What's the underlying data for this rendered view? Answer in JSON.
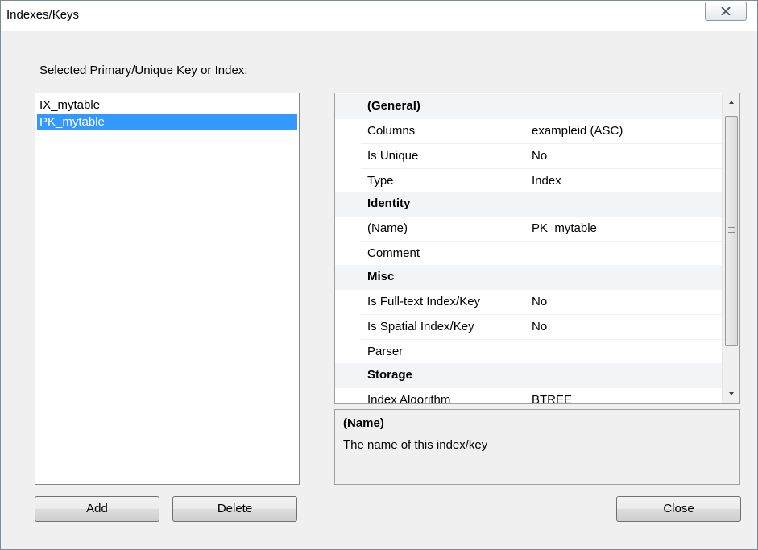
{
  "window": {
    "title": "Indexes/Keys"
  },
  "prompt": "Selected Primary/Unique Key or Index:",
  "key_list": {
    "items": [
      "IX_mytable",
      "PK_mytable"
    ],
    "selected": "PK_mytable"
  },
  "buttons": {
    "add": "Add",
    "delete": "Delete",
    "close": "Close"
  },
  "property_grid": {
    "categories": [
      {
        "name": "(General)",
        "rows": [
          {
            "name": "Columns",
            "value": "exampleid (ASC)"
          },
          {
            "name": "Is Unique",
            "value": "No"
          },
          {
            "name": "Type",
            "value": "Index"
          }
        ]
      },
      {
        "name": "Identity",
        "rows": [
          {
            "name": "(Name)",
            "value": "PK_mytable"
          },
          {
            "name": "Comment",
            "value": ""
          }
        ]
      },
      {
        "name": "Misc",
        "rows": [
          {
            "name": "Is Full-text Index/Key",
            "value": "No"
          },
          {
            "name": "Is Spatial Index/Key",
            "value": "No"
          },
          {
            "name": "Parser",
            "value": ""
          }
        ]
      },
      {
        "name": "Storage",
        "rows": [
          {
            "name": "Index Algorithm",
            "value": "BTREE"
          }
        ]
      }
    ]
  },
  "description": {
    "title": "(Name)",
    "text": "The name of this index/key"
  },
  "colors": {
    "selection": "#3399ff",
    "category_bg": "#f2f4f8",
    "window_bg": "#f0f0f0"
  }
}
